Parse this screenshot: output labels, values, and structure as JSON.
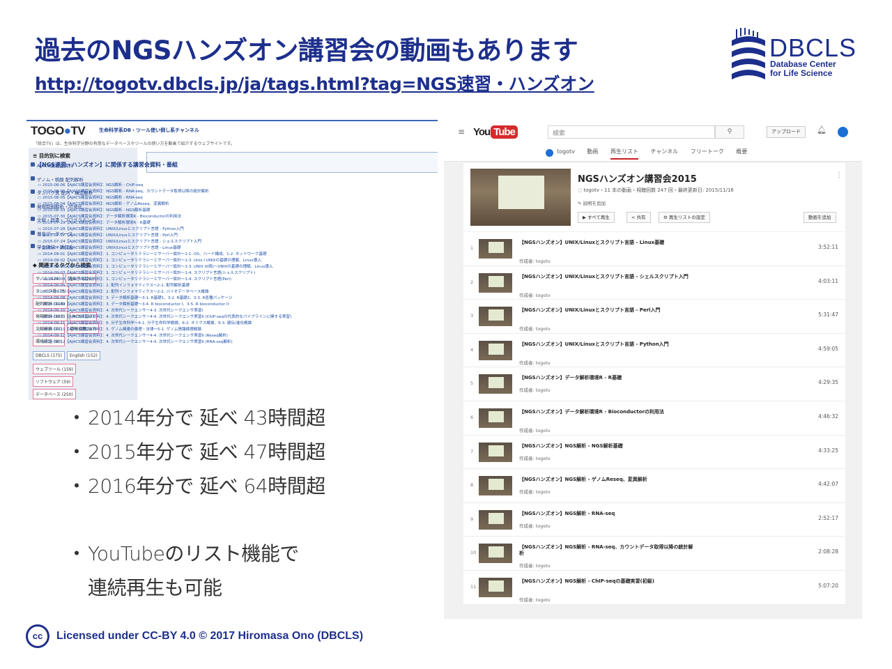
{
  "slide": {
    "title": "過去のNGSハンズオン講習会の動画もあります",
    "link": "http://togotv.dbcls.jp/ja/tags.html?tag=NGS速習・ハンズオン",
    "logo": {
      "name": "DBCLS",
      "sub1": "Database Center",
      "sub2": "for Life Science"
    }
  },
  "togotv": {
    "logo_prefix": "TOGO",
    "logo_o": "●",
    "logo_suffix": "TV",
    "tagline": "生命科学系DB・ツール使い倒し系チャンネル",
    "description": "「統合TV」は、生命科学分野の有用なデータベースやツールの使い方を動画で紹介するウェブサイトです。",
    "sidebar_heading": "目的別に検索",
    "nav": [
      "AJACS講習会資料",
      "ゲノム・核酸 配列解析",
      "タンパク質 配列・構造解析",
      "発現制御解析・可視化",
      "文献・辞書・プログラミング",
      "著名データベース",
      "学会講演・講習会"
    ],
    "tags_heading": "関連するタグから検索",
    "tag_rows": [
      [
        "ゲノム (126)",
        "遺伝子 (220)"
      ],
      [
        "タンパク質 (75)"
      ],
      [
        "配列解析 (116)"
      ],
      [
        "発現解析 (183)",
        "NGS (117)"
      ],
      [
        "文献検索 (73)",
        "情報収集 (47)"
      ],
      [
        "環境設定 (90)"
      ],
      [
        "DBCLS (175)",
        "English (152)"
      ],
      [
        "ウェブツール (159)"
      ],
      [
        "ソフトウェア (59)"
      ],
      [
        "データベース (250)"
      ]
    ],
    "main_title": "【NGS速習・ハンズオン】に関係する講習会資料・番組",
    "items": [
      "2015-08-06【AJACS講習会資料】：NGS解析 - ChIP-seq",
      "2015-08-05【AJACS講習会資料】：NGS解析 - RNA-seq、カウントデータ取得以降の統計解析",
      "2015-08-05【AJACS講習会資料】：NGS解析 - RNA-seq",
      "2015-08-04【AJACS講習会資料】：NGS解析 - ゲノムReseq、変異解析",
      "2015-08-03【AJACS講習会資料】：NGS解析 - NGS解析基礎",
      "2015-07-30【AJACS講習会資料】：データ解析環境R - Bioconductorの利用法",
      "2015-07-29【AJACS講習会資料】：データ解析環境R - R基礎",
      "2015-07-28【AJACS講習会資料】：UNIX/Linuxとスクリプト言語 - Python入門",
      "2015-07-27【AJACS講習会資料】：UNIX/Linuxとスクリプト言語 - Perl入門",
      "2015-07-24【AJACS講習会資料】：UNIX/Linuxとスクリプト言語 - シェルスクリプト入門",
      "2015-07-23【AJACS講習会資料】：UNIX/Linuxとスクリプト言語 - Linux基礎",
      "2014-09-01【AJACS講習会資料】：1. コンピュータリテラシーとサーバー設計〜1-1. OS、ハード構成、1-2. ネットワーク基礎",
      "2014-09-02【AJACS講習会資料】：1. コンピュータリテラシーとサーバー設計〜1-3. Unix I UNIXの基礎の理解、Linux導入",
      "2014-09-03【AJACS講習会資料】：1. コンピュータリテラシーとサーバー設計〜1-3. UNIX II(続)〜UNIXの基礎の理解、Linux導入",
      "2014-09-03【AJACS講習会資料】：1. コンピュータリテラシーとサーバー設計〜1-4. スクリプト言語(シェルスクリプト)",
      "2014-09-04【AJACS講習会資料】：1. コンピュータリテラシーとサーバー設計〜1-4. スクリプト言語(Perl)",
      "2014-09-05【AJACS講習会資料】：2. 配列インフォマティクス〜2-1. 配列解析基礎",
      "2014-09-05【AJACS講習会資料】：2. 配列インフォマティクス〜2-2. バイオデータベース概論",
      "2014-09-08【AJACS講習会資料】：3. データ解析基礎〜3-1. R基礎1、3-2. R基礎2、3-3. R各種パッケージ",
      "2014-09-09【AJACS講習会資料】：3. データ解析基礎〜3-4. R bioconductor I、3-5. R bioconductor II",
      "2014-09-10【AJACS講習会資料】：4. 次世代シークエンサー4-3. 次世代シークエンサ実習I",
      "2014-09-11【AJACS講習会資料】：4. 次世代シークエンサー4-4. 次世代シークエンサ実習II (ChIP-seqの代表的なパイプラインに関する実習)",
      "2014-09-11【AJACS講習会資料】：6. 分子生命科学〜6-1. 分子生命科学概論、6-2. オミクス概論、6-3. 遺伝/進化概論",
      "2014-09-11【AJACS講習会資料】：5. ゲノム関連の倫理・法律〜5-1. ゲノム情報倫理概論",
      "2014-09-12【AJACS講習会資料】：4. 次世代シークエンサー4-4. 次世代シークエンサ実習II (Reseq解析)",
      "2014-09-12【AJACS講習会資料】：4. 次世代シークエンサー4-4. 次世代シークエンサ実習II (RNA-seq解析)"
    ]
  },
  "bullets": {
    "b1": "2014年分で 延べ 43時間超",
    "b2": "2015年分で 延べ 47時間超",
    "b3": "2016年分で 延べ 64時間超",
    "b4_line1": "YouTubeのリスト機能で",
    "b4_line2": "連続再生も可能",
    "dot": "・"
  },
  "youtube": {
    "logo_you": "You",
    "logo_tube": "Tube",
    "search_placeholder": "検索",
    "upload_label": "アップロード",
    "tabs": [
      "togotv",
      "動画",
      "再生リスト",
      "チャンネル",
      "フリートーク",
      "概要"
    ],
    "active_tab": "再生リスト",
    "playlist_title": "NGSハンズオン講習会2015",
    "playlist_meta": "togotv・11 本の動画・視聴回数 247 回・最終更新日: 2015/11/16",
    "add_description": "説明を追加",
    "btn_play_all": "▶ すべて再生",
    "btn_share": "< 共有",
    "btn_settings": "⚙ 再生リストの設定",
    "btn_add_video": "動画を追加",
    "author_label": "作成者: togotv",
    "videos": [
      {
        "num": "1",
        "title": "【NGSハンズオン】UNIX/Linuxとスクリプト言語 - Linux基礎",
        "duration": "3:52:11"
      },
      {
        "num": "2",
        "title": "【NGSハンズオン】UNIX/Linuxとスクリプト言語 - シェルスクリプト入門",
        "duration": "4:03:11"
      },
      {
        "num": "3",
        "title": "【NGSハンズオン】UNIX/Linuxとスクリプト言語 - Perl入門",
        "duration": "5:31:47"
      },
      {
        "num": "4",
        "title": "【NGSハンズオン】UNIX/Linuxとスクリプト言語 - Python入門",
        "duration": "4:59:05"
      },
      {
        "num": "5",
        "title": "【NGSハンズオン】データ解析環境R - R基礎",
        "duration": "4:29:35"
      },
      {
        "num": "6",
        "title": "【NGSハンズオン】データ解析環境R - Bioconductorの利用法",
        "duration": "4:46:32"
      },
      {
        "num": "7",
        "title": "【NGSハンズオン】NGS解析 - NGS解析基礎",
        "duration": "4:33:25"
      },
      {
        "num": "8",
        "title": "【NGSハンズオン】NGS解析 - ゲノムReseq、変異解析",
        "duration": "4:42:07"
      },
      {
        "num": "9",
        "title": "【NGSハンズオン】NGS解析 - RNA-seq",
        "duration": "2:52:17"
      },
      {
        "num": "10",
        "title": "【NGSハンズオン】NGS解析 - RNA-seq、カウントデータ取得以降の統計解析",
        "duration": "2:08:28"
      },
      {
        "num": "11",
        "title": "【NGSハンズオン】NGS解析 - ChIP-seqの基礎実習(初級)",
        "duration": "5:07:20"
      }
    ]
  },
  "license": {
    "cc": "cc",
    "text": "Licensed under CC-BY 4.0 © 2017 Hiromasa Ono (DBCLS)"
  },
  "colors": {
    "brand": "#1d2f8c",
    "link": "#1d4fa8",
    "youtube_red": "#d52b2b"
  }
}
